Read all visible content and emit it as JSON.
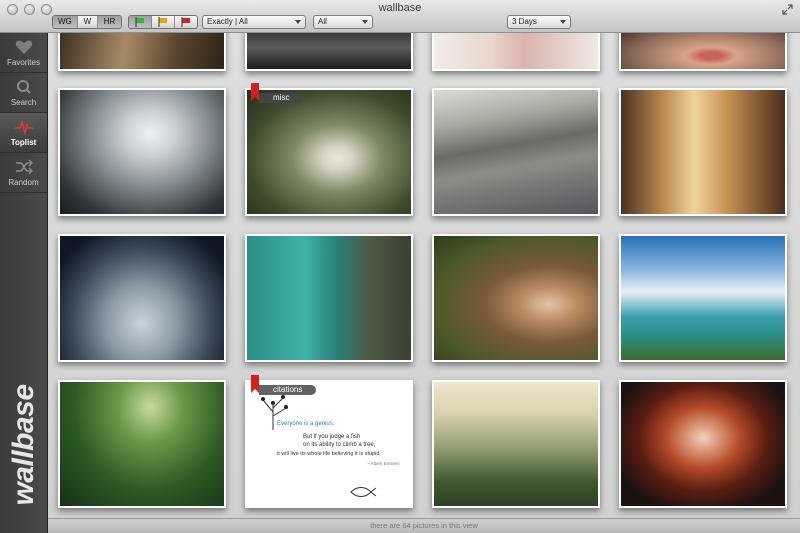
{
  "window": {
    "title": "wallbase"
  },
  "toolbar": {
    "resolution_segments": [
      "WG",
      "W",
      "HR"
    ],
    "purity_flags": [
      {
        "name": "flag-green-icon",
        "color": "#3fae3f",
        "checked": true
      },
      {
        "name": "flag-yellow-icon",
        "color": "#e6a21b",
        "checked": false
      },
      {
        "name": "flag-red-icon",
        "color": "#d62323",
        "checked": false
      }
    ],
    "match_select": "Exactly | All",
    "category_select": "All",
    "timespan_select": "3 Days"
  },
  "sidebar": {
    "items": [
      {
        "label": "Favorites",
        "icon": "heart-icon",
        "active": false
      },
      {
        "label": "Search",
        "icon": "magnifier-icon",
        "active": false
      },
      {
        "label": "Toplist",
        "icon": "pulse-graph-icon",
        "active": true,
        "accent": "#e0383a"
      },
      {
        "label": "Random",
        "icon": "shuffle-icon",
        "active": false
      }
    ],
    "logo_text": "wallbase"
  },
  "grid": {
    "tags": {
      "misc": "misc",
      "citations": "citations"
    },
    "quote": {
      "line1": "Everyone is a genius.",
      "line2": "But if you judge a fish",
      "line3": "on its ability to climb a tree,",
      "line4": "it will live its whole life believing it is stupid.",
      "author": "~ Albert Einstein"
    }
  },
  "status": {
    "text": "there are 64 pictures in this view"
  }
}
